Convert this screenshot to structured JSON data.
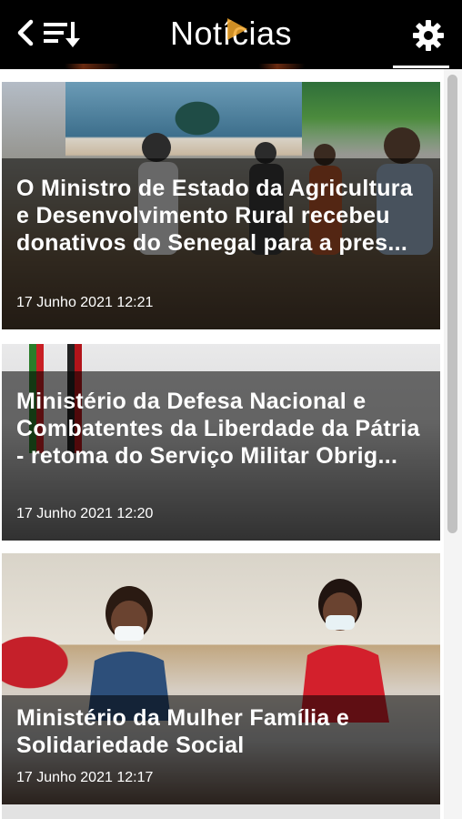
{
  "header": {
    "title": "Notícias",
    "back_icon": "chevron-left-icon",
    "sort_icon": "sort-down-icon",
    "settings_icon": "gear-icon",
    "background": "#000000",
    "text_color": "#ffffff"
  },
  "articles": [
    {
      "headline": "O Ministro de Estado da Agricultura e Desenvolvimento Rural recebeu donativos do Senegal para a pres...",
      "date": "17 Junho 2021 12:21"
    },
    {
      "headline": "Ministério da Defesa Nacional e Combatentes da Liberdade da Pátria - retoma do Serviço Militar Obrig...",
      "date": "17 Junho 2021 12:20"
    },
    {
      "headline": "Ministério da Mulher Família e Solidariedade Social",
      "date": "17 Junho 2021 12:17"
    }
  ],
  "colors": {
    "overlay": "rgba(0,0,0,0.55)",
    "scroll_thumb": "#c1c1c1"
  }
}
